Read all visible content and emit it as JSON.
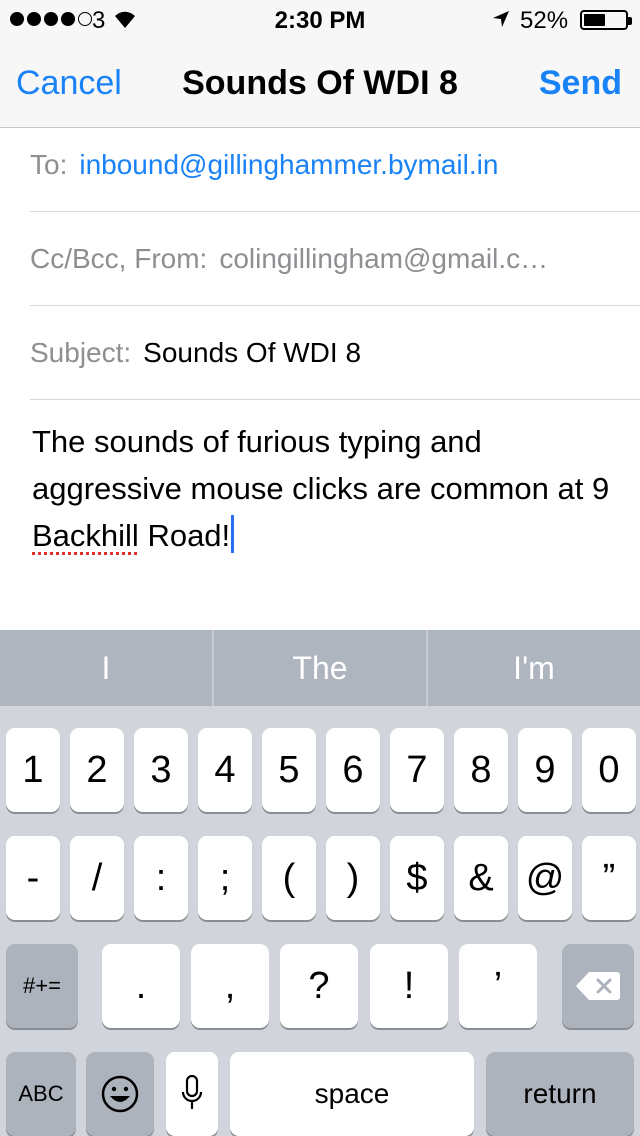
{
  "status": {
    "carrier": "3",
    "time": "2:30 PM",
    "battery": "52%",
    "battery_level": 0.52
  },
  "nav": {
    "cancel": "Cancel",
    "title": "Sounds Of WDI 8",
    "send": "Send"
  },
  "fields": {
    "to_label": "To:",
    "to_value": "inbound@gillinghammer.bymail.in",
    "cc_label": "Cc/Bcc, From:",
    "cc_value": "colingillingham@gmail.c…",
    "subject_label": "Subject:",
    "subject_value": "Sounds Of WDI 8"
  },
  "body": {
    "text_before": "The sounds of furious typing and aggressive mouse clicks are common at 9 ",
    "misspelled": "Backhill",
    "text_after": " Road!"
  },
  "suggestions": [
    "I",
    "The",
    "I'm"
  ],
  "keyboard": {
    "row1": [
      "1",
      "2",
      "3",
      "4",
      "5",
      "6",
      "7",
      "8",
      "9",
      "0"
    ],
    "row2": [
      "-",
      "/",
      ":",
      ";",
      "(",
      ")",
      "$",
      "&",
      "@",
      "”"
    ],
    "row3": {
      "toggle": "#+=",
      "keys": [
        ".",
        ",",
        "?",
        "!",
        "’"
      ]
    },
    "row4": {
      "abc": "ABC",
      "space": "space",
      "return": "return"
    }
  },
  "colors": {
    "accent": "#1a82f7",
    "keyboard_bg": "#d1d5db",
    "suggestion_bg": "#aeb5bf"
  }
}
